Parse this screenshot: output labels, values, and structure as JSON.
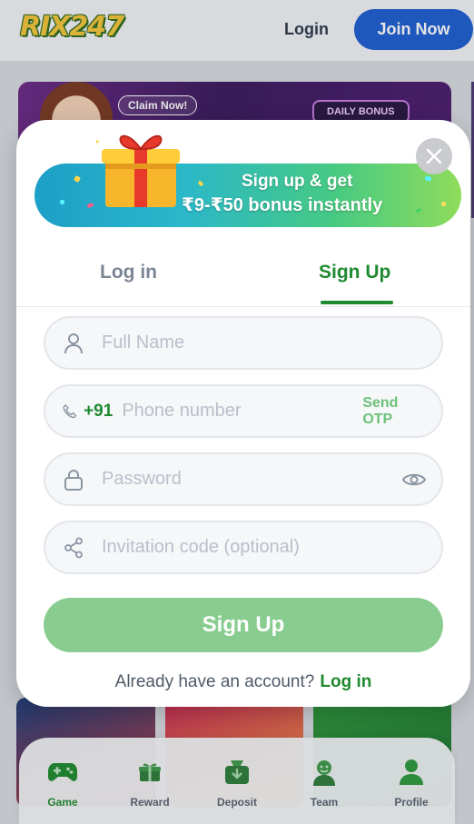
{
  "header": {
    "logo_text": "RIX247",
    "login_label": "Login",
    "join_label": "Join Now"
  },
  "banner": {
    "claim_label": "Claim Now!",
    "daily_label": "DAILY BONUS"
  },
  "bottom_nav": {
    "items": [
      {
        "label": "Game",
        "icon": "gamepad-icon",
        "active": true
      },
      {
        "label": "Reward",
        "icon": "gift-icon",
        "active": false
      },
      {
        "label": "Deposit",
        "icon": "wallet-icon",
        "active": false
      },
      {
        "label": "Team",
        "icon": "team-icon",
        "active": false
      },
      {
        "label": "Profile",
        "icon": "profile-icon",
        "active": false
      }
    ]
  },
  "modal": {
    "promo": {
      "line1": "Sign up & get",
      "line2": "₹9-₹50 bonus instantly"
    },
    "tabs": {
      "login": "Log in",
      "signup": "Sign Up",
      "active": "signup"
    },
    "fields": {
      "full_name": {
        "placeholder": "Full Name",
        "value": ""
      },
      "phone": {
        "country_code": "+91",
        "placeholder": "Phone number",
        "value": "",
        "otp_label": "Send OTP"
      },
      "password": {
        "placeholder": "Password",
        "value": ""
      },
      "invitation": {
        "placeholder": "Invitation code (optional)",
        "value": ""
      }
    },
    "submit_label": "Sign Up",
    "footer_text": "Already have an account?",
    "footer_link": "Log in"
  },
  "colors": {
    "accent_green": "#1f8a2f",
    "button_disabled_green": "#88cd8f",
    "join_blue": "#1d5fd1"
  }
}
